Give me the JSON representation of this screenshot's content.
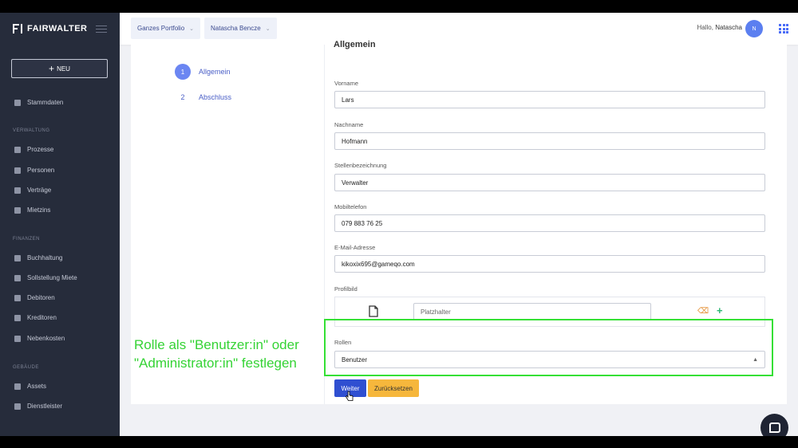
{
  "app": {
    "brand": "FAIRWALTER",
    "new_button": "NEU"
  },
  "sidebar": {
    "top_items": [
      {
        "label": "Stammdaten"
      }
    ],
    "sections": [
      {
        "title": "VERWALTUNG",
        "items": [
          "Prozesse",
          "Personen",
          "Verträge",
          "Mietzins"
        ]
      },
      {
        "title": "FINANZEN",
        "items": [
          "Buchhaltung",
          "Sollstellung Miete",
          "Debitoren",
          "Kreditoren",
          "Nebenkosten"
        ]
      },
      {
        "title": "GEBÄUDE",
        "items": [
          "Assets",
          "Dienstleister"
        ]
      }
    ]
  },
  "header": {
    "portfolio_dropdown": "Ganzes Portfolio",
    "user_dropdown": "Natascha Bencze",
    "hello": "Hallo,",
    "user_name": "Natascha",
    "avatar_initials": "N"
  },
  "steps": [
    {
      "number": "1",
      "label": "Allgemein",
      "active": true
    },
    {
      "number": "2",
      "label": "Abschluss",
      "active": false
    }
  ],
  "form": {
    "section_title": "Allgemein",
    "fields": [
      {
        "label": "Vorname",
        "value": "Lars"
      },
      {
        "label": "Nachname",
        "value": "Hofmann"
      },
      {
        "label": "Stellenbezeichnung",
        "value": "Verwalter"
      },
      {
        "label": "Mobiltelefon",
        "value": "079 883 76 25"
      },
      {
        "label": "E-Mail-Adresse",
        "value": "kikoxix695@gameqo.com"
      }
    ],
    "profile_label": "Profilbild",
    "profile_placeholder": "Platzhalter",
    "roles_label": "Rollen",
    "roles_value": "Benutzer",
    "next_button": "Weiter",
    "reset_button": "Zurücksetzen"
  },
  "annotation": {
    "text": "Rolle als \"Benutzer:in\" oder\n\"Administrator:in\" festlegen",
    "color": "#35e035"
  },
  "colors": {
    "sidebar_bg": "#262c3b",
    "primary": "#2f4fd1",
    "secondary": "#f6b73c",
    "accent": "#5b7ff0"
  }
}
